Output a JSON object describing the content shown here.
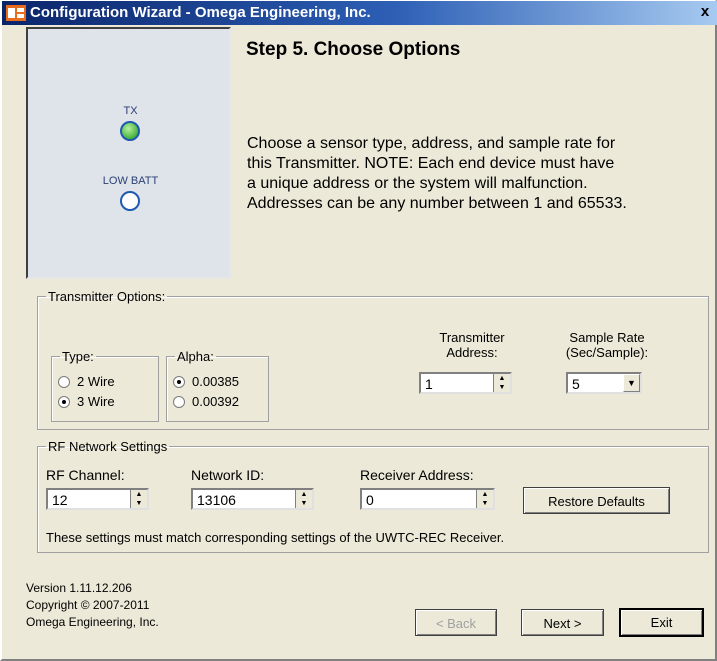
{
  "window": {
    "title": "Configuration Wizard - Omega Engineering, Inc.",
    "close_glyph": "x"
  },
  "leds": {
    "tx_label": "TX",
    "low_batt_label": "LOW BATT"
  },
  "step": {
    "title": "Step 5.  Choose Options",
    "description": [
      "Choose a sensor type, address, and sample rate for",
      "this Transmitter.  NOTE: Each end device must have",
      "a unique address or the system will malfunction.",
      "Addresses can be any number between 1 and 65533."
    ]
  },
  "transmitter_options": {
    "legend": "Transmitter Options:",
    "type": {
      "legend": "Type:",
      "options": [
        "2 Wire",
        "3 Wire"
      ],
      "selected": "3 Wire"
    },
    "alpha": {
      "legend": "Alpha:",
      "options": [
        "0.00385",
        "0.00392"
      ],
      "selected": "0.00385"
    },
    "address_label_line1": "Transmitter",
    "address_label_line2": "Address:",
    "address_value": "1",
    "sample_rate_label_line1": "Sample Rate",
    "sample_rate_label_line2": "(Sec/Sample):",
    "sample_rate_value": "5"
  },
  "rf_network": {
    "legend": "RF Network Settings",
    "channel_label": "RF Channel:",
    "channel_value": "12",
    "network_id_label": "Network ID:",
    "network_id_value": "13106",
    "receiver_address_label": "Receiver Address:",
    "receiver_address_value": "0",
    "restore_defaults_label": "Restore Defaults",
    "note": "These settings must match corresponding settings of the UWTC-REC Receiver."
  },
  "footer": {
    "version": "Version 1.11.12.206",
    "copyright": "Copyright © 2007-2011",
    "company": "Omega Engineering, Inc.",
    "back_label": "< Back",
    "next_label": "Next >",
    "exit_label": "Exit"
  },
  "colors": {
    "title_bar": "#0a246a",
    "tx_led": "#46b33c",
    "led_ring": "#1f59b0",
    "dialog_bg": "#ece9d8"
  }
}
